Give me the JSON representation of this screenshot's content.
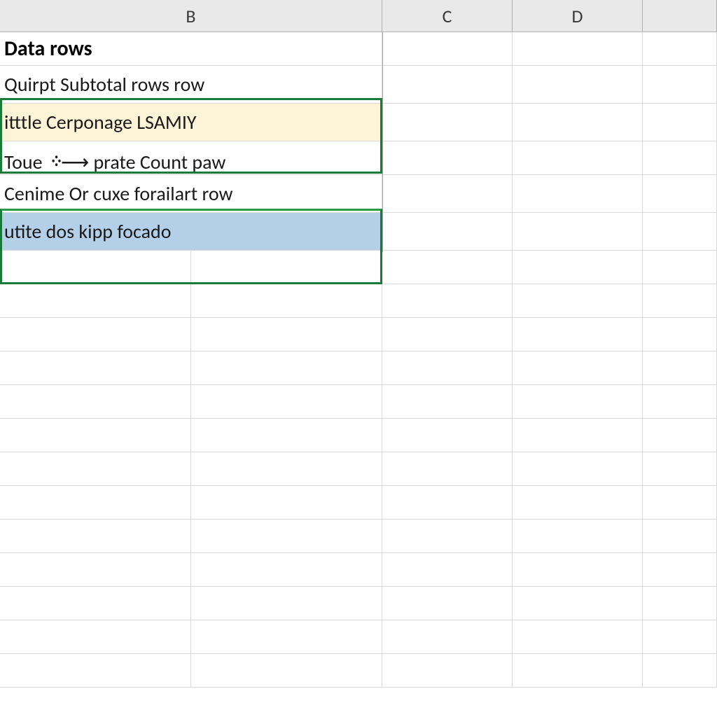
{
  "columns": {
    "B": "B",
    "C": "C",
    "D": "D",
    "E": ""
  },
  "rows": {
    "r1": {
      "b": "Data rows"
    },
    "r2": {
      "b": "Quirpt Subtotal rows row"
    },
    "r3": {
      "b": "itttle Cerponage LSAMIY"
    },
    "r4": {
      "b": "Toue ᠅⟶ prate Count paw"
    },
    "r5": {
      "b": "Cenime Or cuxe forailart row"
    },
    "r6": {
      "b": "utite dos kipp focado"
    }
  },
  "selection": {
    "range_top": "B2:B3",
    "range_bottom": "B5:B6",
    "active_fill": "#b4cfe8",
    "alt_fill": "#fdf3d6",
    "border_color": "#1a7a3a"
  }
}
